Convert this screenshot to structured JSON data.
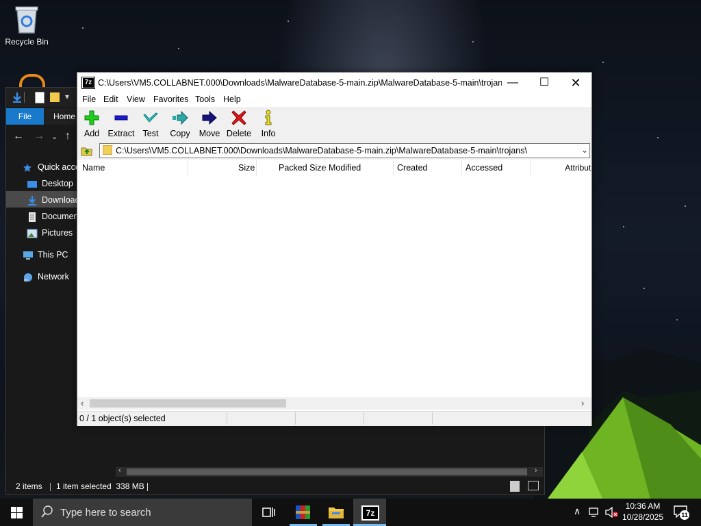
{
  "desktop": {
    "recycle_bin_label": "Recycle Bin"
  },
  "explorer": {
    "ribbon_file_tab": "File",
    "ribbon_home_tab": "Home",
    "sidebar": {
      "items": [
        {
          "label": "Quick access",
          "icon": "star-icon"
        },
        {
          "label": "Desktop",
          "icon": "desktop-folder-icon"
        },
        {
          "label": "Downloads",
          "icon": "download-arrow-icon"
        },
        {
          "label": "Documents",
          "icon": "document-icon"
        },
        {
          "label": "Pictures",
          "icon": "pictures-icon"
        },
        {
          "label": "This PC",
          "icon": "computer-icon"
        },
        {
          "label": "Network",
          "icon": "network-icon"
        }
      ]
    },
    "status": {
      "items_count": "2 items",
      "selected": "1 item selected  338 MB"
    }
  },
  "sevenzip": {
    "app_icon_text": "7z",
    "title": "C:\\Users\\VM5.COLLABNET.000\\Downloads\\MalwareDatabase-5-main.zip\\MalwareDatabase-5-main\\trojans\\...",
    "menu": [
      "File",
      "Edit",
      "View",
      "Favorites",
      "Tools",
      "Help"
    ],
    "toolbar": {
      "add": "Add",
      "extract": "Extract",
      "test": "Test",
      "copy": "Copy",
      "move": "Move",
      "delete": "Delete",
      "info": "Info"
    },
    "address": "C:\\Users\\VM5.COLLABNET.000\\Downloads\\MalwareDatabase-5-main.zip\\MalwareDatabase-5-main\\trojans\\",
    "columns": [
      "Name",
      "Size",
      "Packed Size",
      "Modified",
      "Created",
      "Accessed",
      "Attributes"
    ],
    "status": "0 / 1 object(s) selected"
  },
  "taskbar": {
    "search_placeholder": "Type here to search",
    "sevenzip_icon_text": "7z",
    "time": "10:36 AM",
    "date": "10/28/2025",
    "notification_count": "11"
  },
  "colors": {
    "accent": "#1979ca",
    "taskbar": "#101010",
    "explorer_bg": "#191919"
  }
}
